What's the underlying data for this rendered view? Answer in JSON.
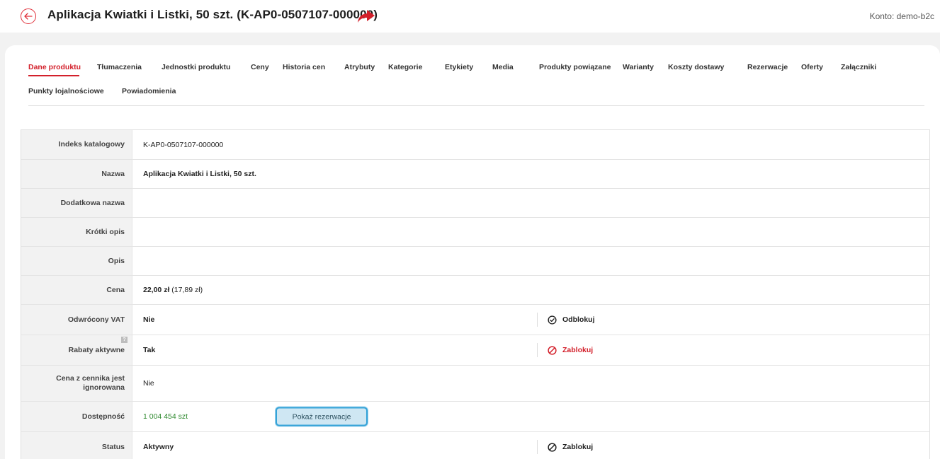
{
  "header": {
    "title": "Aplikacja Kwiatki i Listki, 50 szt. (K-AP0-0507107-000000)",
    "account": "Konto: demo-b2c",
    "back_icon": "arrow-left-circle-icon",
    "share_icon": "share-arrow-icon"
  },
  "colors": {
    "accent": "#d3202b",
    "available": "#2f8a2f",
    "highlight_button": "#35a3d8"
  },
  "tabs": {
    "row1": [
      {
        "label": "Dane produktu",
        "active": true
      },
      {
        "label": "Tłumaczenia"
      },
      {
        "label": "Jednostki produktu"
      },
      {
        "label": "Ceny"
      },
      {
        "label": "Historia cen"
      },
      {
        "label": "Atrybuty"
      },
      {
        "label": "Kategorie"
      },
      {
        "label": "Etykiety"
      },
      {
        "label": "Media"
      },
      {
        "label": "Produkty powiązane"
      },
      {
        "label": "Warianty"
      },
      {
        "label": "Koszty dostawy"
      },
      {
        "label": "Rezerwacje"
      },
      {
        "label": "Oferty"
      },
      {
        "label": "Załączniki"
      }
    ],
    "row2": [
      {
        "label": "Punkty lojalnościowe"
      },
      {
        "label": "Powiadomienia"
      }
    ]
  },
  "fields": {
    "catalog_index": {
      "label": "Indeks katalogowy",
      "value": "K-AP0-0507107-000000"
    },
    "name": {
      "label": "Nazwa",
      "value": "Aplikacja Kwiatki i Listki, 50 szt."
    },
    "extra_name": {
      "label": "Dodatkowa nazwa",
      "value": ""
    },
    "short_desc": {
      "label": "Krótki opis",
      "value": ""
    },
    "desc": {
      "label": "Opis",
      "value": ""
    },
    "price": {
      "label": "Cena",
      "gross": "22,00 zł",
      "net": "(17,89 zł)"
    },
    "reverse_vat": {
      "label": "Odwrócony VAT",
      "value": "Nie",
      "action": "Odblokuj",
      "help": ""
    },
    "discounts": {
      "label": "Rabaty aktywne",
      "value": "Tak",
      "action": "Zablokuj",
      "help": "?"
    },
    "ignore_pricelist": {
      "label_line1": "Cena z cennika jest",
      "label_line2": "ignorowana",
      "value": "Nie"
    },
    "availability": {
      "label": "Dostępność",
      "value": "1 004 454 szt",
      "button": "Pokaż rezerwacje"
    },
    "status": {
      "label": "Status",
      "value": "Aktywny",
      "action": "Zablokuj"
    }
  }
}
